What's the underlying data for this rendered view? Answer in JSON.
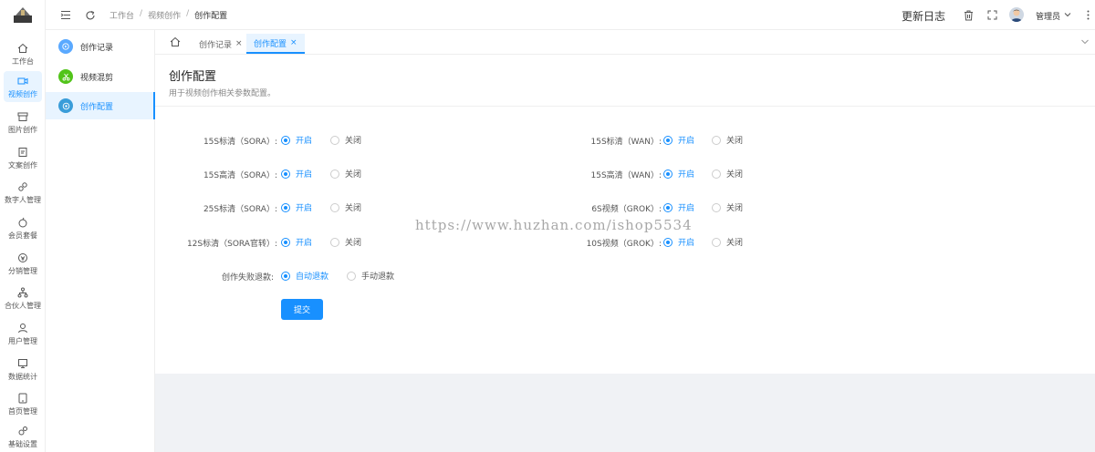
{
  "rail": {
    "items": [
      {
        "label": "工作台",
        "icon": "home-icon",
        "active": false
      },
      {
        "label": "视频创作",
        "icon": "video-icon",
        "active": true
      },
      {
        "label": "图片创作",
        "icon": "image-icon",
        "active": false
      },
      {
        "label": "文案创作",
        "icon": "edit-doc-icon",
        "active": false
      },
      {
        "label": "数字人管理",
        "icon": "digital-human-icon",
        "active": false
      },
      {
        "label": "会员套餐",
        "icon": "member-icon",
        "active": false
      },
      {
        "label": "分销管理",
        "icon": "distribution-icon",
        "active": false
      },
      {
        "label": "合伙人管理",
        "icon": "partner-icon",
        "active": false
      },
      {
        "label": "用户管理",
        "icon": "user-icon",
        "active": false
      },
      {
        "label": "数据统计",
        "icon": "stats-icon",
        "active": false
      },
      {
        "label": "首页管理",
        "icon": "tablet-icon",
        "active": false
      },
      {
        "label": "基础设置",
        "icon": "settings-icon",
        "active": false
      }
    ]
  },
  "topbar": {
    "breadcrumbs": [
      "工作台",
      "视频创作",
      "创作配置"
    ],
    "changelog": "更新日志",
    "admin": "管理员"
  },
  "subnav": {
    "items": [
      {
        "label": "创作记录",
        "color": "#5aa9ff",
        "icon": "play-icon",
        "active": false
      },
      {
        "label": "视频混剪",
        "color": "#52c41a",
        "icon": "scissors-icon",
        "active": false
      },
      {
        "label": "创作配置",
        "color": "#3a9dd9",
        "icon": "config-icon",
        "active": true
      }
    ]
  },
  "tabs": [
    {
      "label": "创作记录",
      "active": false
    },
    {
      "label": "创作配置",
      "active": true
    }
  ],
  "page": {
    "title": "创作配置",
    "subtitle": "用于视频创作相关参数配置。",
    "on_label": "开启",
    "off_label": "关闭",
    "settings_left": [
      {
        "label": "15S标清（SORA）:",
        "value": "开启"
      },
      {
        "label": "15S高清（SORA）:",
        "value": "开启"
      },
      {
        "label": "25S标清（SORA）:",
        "value": "开启"
      },
      {
        "label": "12S标清（SORA官转）:",
        "value": "开启"
      }
    ],
    "settings_right": [
      {
        "label": "15S标清（WAN）:",
        "value": "开启"
      },
      {
        "label": "15S高清（WAN）:",
        "value": "开启"
      },
      {
        "label": "6S视频（GROK）:",
        "value": "开启"
      },
      {
        "label": "10S视频（GROK）:",
        "value": "开启"
      }
    ],
    "refund": {
      "label": "创作失败退款:",
      "options": [
        "自动退款",
        "手动退款"
      ],
      "value": "自动退款"
    },
    "submit_label": "提交"
  },
  "watermark": "https://www.huzhan.com/ishop5534",
  "colors": {
    "accent": "#1890ff",
    "active_bg": "#e8f4ff",
    "content_bg": "#f0f2f5"
  }
}
